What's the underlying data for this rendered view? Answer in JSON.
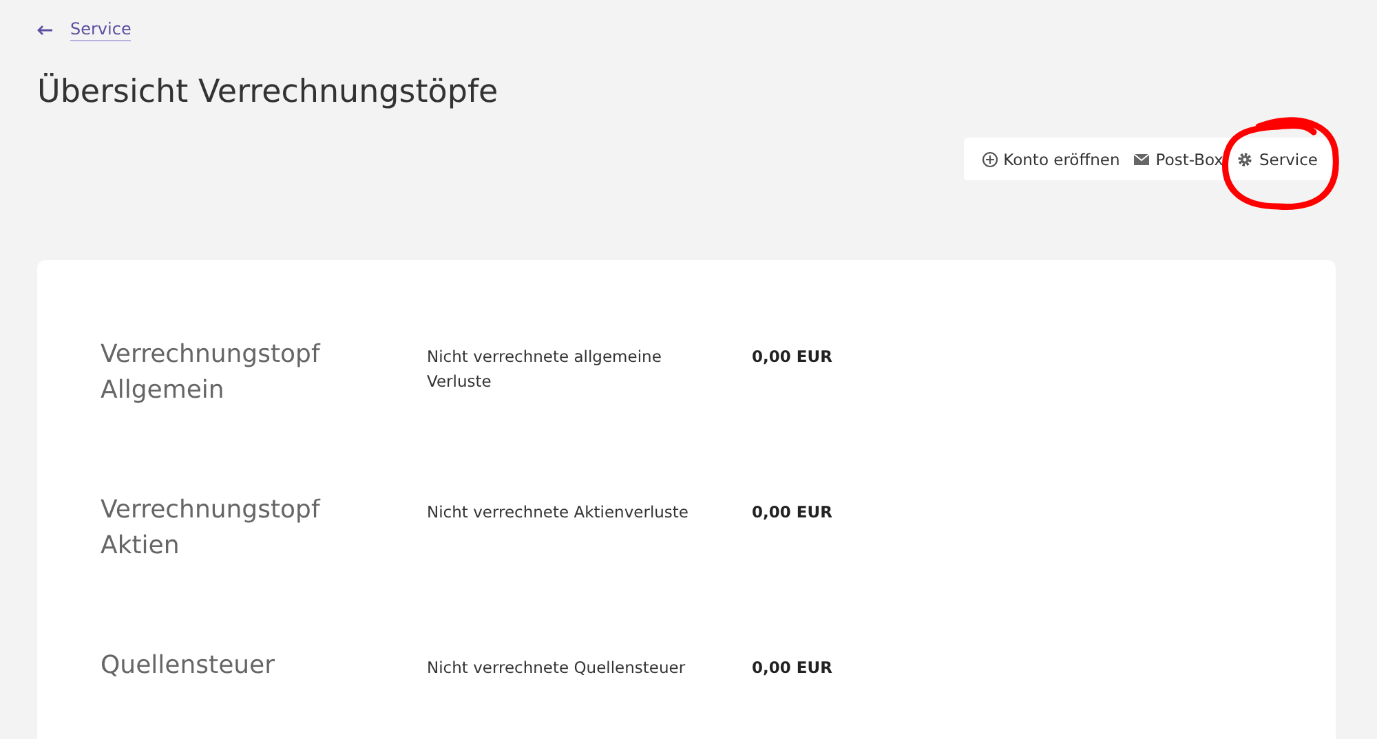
{
  "breadcrumb": {
    "label": "Service"
  },
  "title": "Übersicht Verrechnungstöpfe",
  "toolbar": [
    {
      "kind": "add",
      "label": "Konto eröffnen"
    },
    {
      "kind": "mail",
      "label": "Post-Box"
    },
    {
      "kind": "gear",
      "label": "Service"
    }
  ],
  "annotation": {
    "kind": "circle",
    "color": "#ff0000"
  },
  "pots": [
    {
      "name": "Verrechnungstopf Allgemein",
      "description": "Nicht verrechnete allgemeine Verluste",
      "amount": "0,00 EUR"
    },
    {
      "name": "Verrechnungstopf Aktien",
      "description": "Nicht verrechnete Aktienverluste",
      "amount": "0,00 EUR"
    },
    {
      "name": "Quellensteuer",
      "description": "Nicht verrechnete Quellensteuer",
      "amount": "0,00 EUR"
    }
  ]
}
